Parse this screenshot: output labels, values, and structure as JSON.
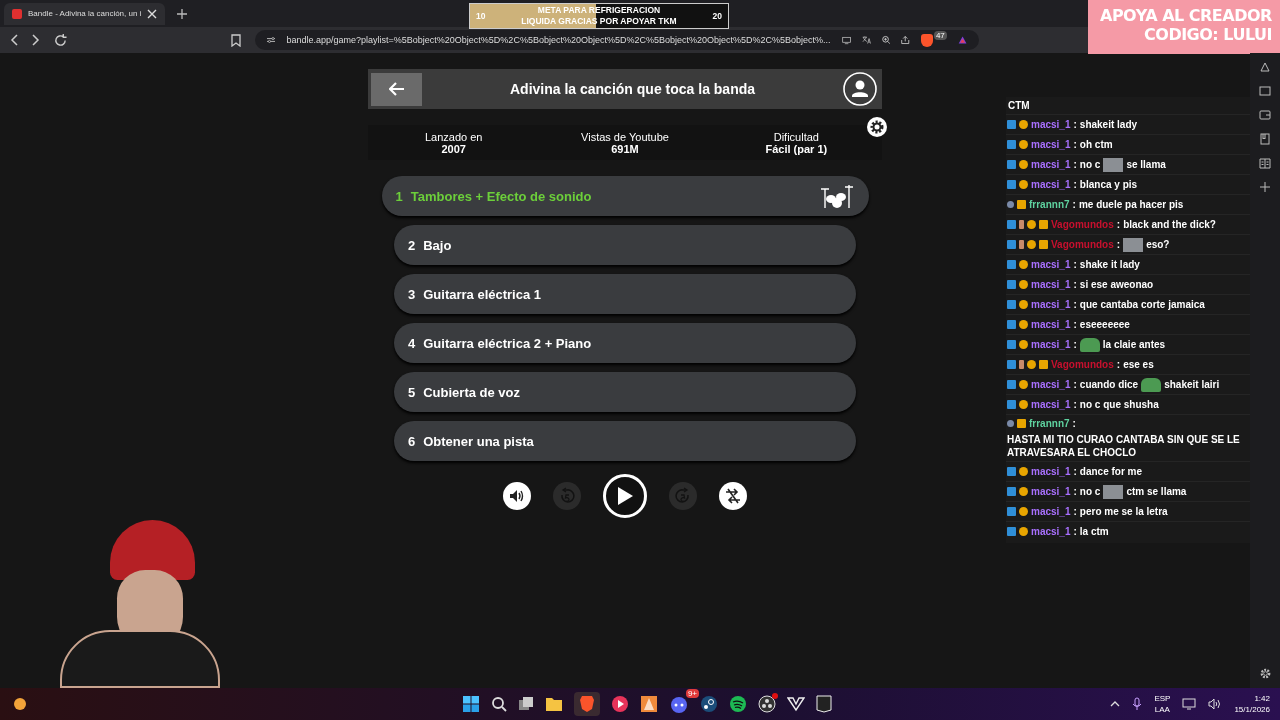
{
  "browser": {
    "tab_title": "Bandle - Adivina la canción, un i",
    "url": "bandle.app/game?playlist=%5Bobject%20Object%5D%2C%5Bobject%20Object%5D%2C%5Bobject%20Object%5D%2C%5Bobject%...",
    "shield_badge": "47"
  },
  "goal_overlay": {
    "start": "10",
    "end": "20",
    "line_1": "META PARA REFRIGERACION",
    "line_2": "LIQUIDA GRACIAS POR APOYAR TKM",
    "level": 0.49
  },
  "promo": {
    "line_1": "APOYA AL CREADOR",
    "line_2": "CODIGO: LULUI"
  },
  "game": {
    "title": "Adivina la canción que toca la banda",
    "stats": [
      {
        "label": "Lanzado en",
        "value": "2007"
      },
      {
        "label": "Vistas de Youtube",
        "value": "691M"
      },
      {
        "label": "Dificultad",
        "value": "Fácil (par 1)"
      }
    ],
    "tracks": [
      {
        "number": "1",
        "name": "Tambores + Efecto de sonido",
        "selected": true
      },
      {
        "number": "2",
        "name": "Bajo",
        "selected": false
      },
      {
        "number": "3",
        "name": "Guitarra eléctrica 1",
        "selected": false
      },
      {
        "number": "4",
        "name": "Guitarra eléctrica 2 + Piano",
        "selected": false
      },
      {
        "number": "5",
        "name": "Cubierta de voz",
        "selected": false
      },
      {
        "number": "6",
        "name": "Obtener una pista",
        "selected": false
      }
    ],
    "controls": [
      {
        "kind": "volume",
        "disabled": false
      },
      {
        "kind": "rewind",
        "disabled": true
      },
      {
        "kind": "play",
        "disabled": false
      },
      {
        "kind": "forward",
        "disabled": true
      },
      {
        "kind": "skip",
        "disabled": false
      }
    ]
  },
  "chat": {
    "top_text": "CTM",
    "messages": [
      {
        "user": "macsi_1",
        "separator": ":",
        "color": "#a970ff",
        "badges": [
          {
            "kind": "prime"
          },
          {
            "kind": "bits"
          }
        ],
        "parts": [
          {
            "kind": "text",
            "text": "shakeit lady"
          }
        ]
      },
      {
        "user": "macsi_1",
        "separator": ":",
        "color": "#a970ff",
        "badges": [
          {
            "kind": "prime"
          },
          {
            "kind": "bits"
          }
        ],
        "parts": [
          {
            "kind": "text",
            "text": "oh ctm"
          }
        ]
      },
      {
        "user": "macsi_1",
        "separator": ":",
        "color": "#a970ff",
        "badges": [
          {
            "kind": "prime"
          },
          {
            "kind": "bits"
          }
        ],
        "parts": [
          {
            "kind": "text",
            "text": "no c"
          },
          {
            "kind": "emote"
          },
          {
            "kind": "text",
            "text": "se llama"
          }
        ]
      },
      {
        "user": "macsi_1",
        "separator": ":",
        "color": "#a970ff",
        "badges": [
          {
            "kind": "prime"
          },
          {
            "kind": "bits"
          }
        ],
        "parts": [
          {
            "kind": "text",
            "text": "blanca y pis"
          }
        ]
      },
      {
        "user": "frrannn7",
        "separator": ":",
        "color": "#5fd3a0",
        "badges": [
          {
            "kind": "dot"
          },
          {
            "kind": "crown"
          }
        ],
        "parts": [
          {
            "kind": "text",
            "text": "me duele pa hacer pis"
          }
        ]
      },
      {
        "user": "Vagomundos",
        "separator": ":",
        "color": "#c8102e",
        "badges": [
          {
            "kind": "prime"
          },
          {
            "kind": "person"
          },
          {
            "kind": "bits"
          },
          {
            "kind": "crown"
          }
        ],
        "parts": [
          {
            "kind": "text",
            "text": "black and the dick?"
          }
        ]
      },
      {
        "user": "Vagomundos",
        "separator": ":",
        "color": "#c8102e",
        "badges": [
          {
            "kind": "prime"
          },
          {
            "kind": "person"
          },
          {
            "kind": "bits"
          },
          {
            "kind": "crown"
          }
        ],
        "parts": [
          {
            "kind": "emote"
          },
          {
            "kind": "text",
            "text": "eso?"
          }
        ]
      },
      {
        "user": "macsi_1",
        "separator": ":",
        "color": "#a970ff",
        "badges": [
          {
            "kind": "prime"
          },
          {
            "kind": "bits"
          }
        ],
        "parts": [
          {
            "kind": "text",
            "text": "shake it lady"
          }
        ]
      },
      {
        "user": "macsi_1",
        "separator": ":",
        "color": "#a970ff",
        "badges": [
          {
            "kind": "prime"
          },
          {
            "kind": "bits"
          }
        ],
        "parts": [
          {
            "kind": "text",
            "text": "si ese aweonao"
          }
        ]
      },
      {
        "user": "macsi_1",
        "separator": ":",
        "color": "#a970ff",
        "badges": [
          {
            "kind": "prime"
          },
          {
            "kind": "bits"
          }
        ],
        "parts": [
          {
            "kind": "text",
            "text": "que cantaba corte jamaica"
          }
        ]
      },
      {
        "user": "macsi_1",
        "separator": ":",
        "color": "#a970ff",
        "badges": [
          {
            "kind": "prime"
          },
          {
            "kind": "bits"
          }
        ],
        "parts": [
          {
            "kind": "text",
            "text": "eseeeeeee"
          }
        ]
      },
      {
        "user": "macsi_1",
        "separator": ":",
        "color": "#a970ff",
        "badges": [
          {
            "kind": "prime"
          },
          {
            "kind": "bits"
          }
        ],
        "parts": [
          {
            "kind": "frog"
          },
          {
            "kind": "text",
            "text": "la claie antes"
          }
        ]
      },
      {
        "user": "Vagomundos",
        "separator": ":",
        "color": "#c8102e",
        "badges": [
          {
            "kind": "prime"
          },
          {
            "kind": "person"
          },
          {
            "kind": "bits"
          },
          {
            "kind": "crown"
          }
        ],
        "parts": [
          {
            "kind": "text",
            "text": "ese es"
          }
        ]
      },
      {
        "user": "macsi_1",
        "separator": ":",
        "color": "#a970ff",
        "badges": [
          {
            "kind": "prime"
          },
          {
            "kind": "bits"
          }
        ],
        "parts": [
          {
            "kind": "text",
            "text": "cuando dice"
          },
          {
            "kind": "frog"
          },
          {
            "kind": "text",
            "text": "shakeit lairi"
          }
        ]
      },
      {
        "user": "macsi_1",
        "separator": ":",
        "color": "#a970ff",
        "badges": [
          {
            "kind": "prime"
          },
          {
            "kind": "bits"
          }
        ],
        "parts": [
          {
            "kind": "text",
            "text": "no c que shusha"
          }
        ]
      },
      {
        "user": "frrannn7",
        "separator": ":",
        "color": "#5fd3a0",
        "badges": [
          {
            "kind": "dot"
          },
          {
            "kind": "crown"
          }
        ],
        "parts": [
          {
            "kind": "text",
            "text": "HASTA MI TIO CURAO CANTABA SIN QUE SE LE ATRAVESARA EL CHOCLO"
          }
        ]
      },
      {
        "user": "macsi_1",
        "separator": ":",
        "color": "#a970ff",
        "badges": [
          {
            "kind": "prime"
          },
          {
            "kind": "bits"
          }
        ],
        "parts": [
          {
            "kind": "text",
            "text": "dance for me"
          }
        ]
      },
      {
        "user": "macsi_1",
        "separator": ":",
        "color": "#a970ff",
        "badges": [
          {
            "kind": "prime"
          },
          {
            "kind": "bits"
          }
        ],
        "parts": [
          {
            "kind": "text",
            "text": "no c"
          },
          {
            "kind": "emote"
          },
          {
            "kind": "text",
            "text": "ctm se llama"
          }
        ]
      },
      {
        "user": "macsi_1",
        "separator": ":",
        "color": "#a970ff",
        "badges": [
          {
            "kind": "prime"
          },
          {
            "kind": "bits"
          }
        ],
        "parts": [
          {
            "kind": "text",
            "text": "pero me se la letra"
          }
        ]
      },
      {
        "user": "macsi_1",
        "separator": ":",
        "color": "#a970ff",
        "badges": [
          {
            "kind": "prime"
          },
          {
            "kind": "bits"
          }
        ],
        "parts": [
          {
            "kind": "text",
            "text": "la ctm"
          }
        ]
      }
    ]
  },
  "taskbar": {
    "discord_badge": "9+",
    "language": "ESP",
    "layout": "LAA",
    "time": "1:42",
    "date": "15/1/2026"
  }
}
